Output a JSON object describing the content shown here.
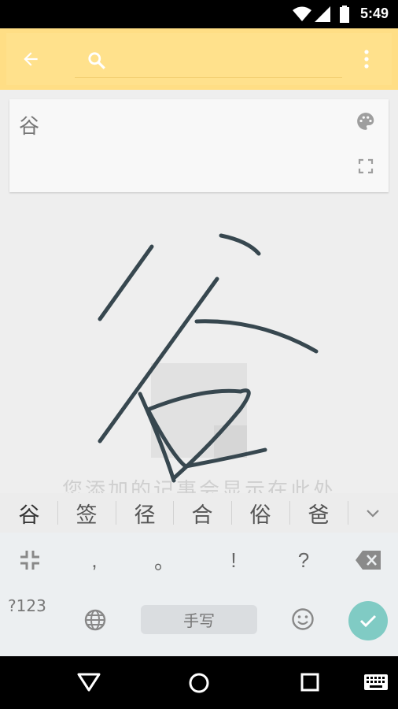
{
  "status_bar": {
    "time": "5:49"
  },
  "app_bar": {
    "search_placeholder": ""
  },
  "note": {
    "text": "谷"
  },
  "empty_state": {
    "text": "您添加的记事会显示在此处"
  },
  "candidates": [
    "谷",
    "签",
    "径",
    "合",
    "俗",
    "爸"
  ],
  "keyboard": {
    "keys_row1": [
      ",",
      "。",
      "!",
      "?"
    ],
    "symbols_label": "?123",
    "handwrite_label": "手写"
  },
  "colors": {
    "app_bar": "#ffde85",
    "accent_done": "#80cbc4",
    "ink": "#37474f"
  }
}
